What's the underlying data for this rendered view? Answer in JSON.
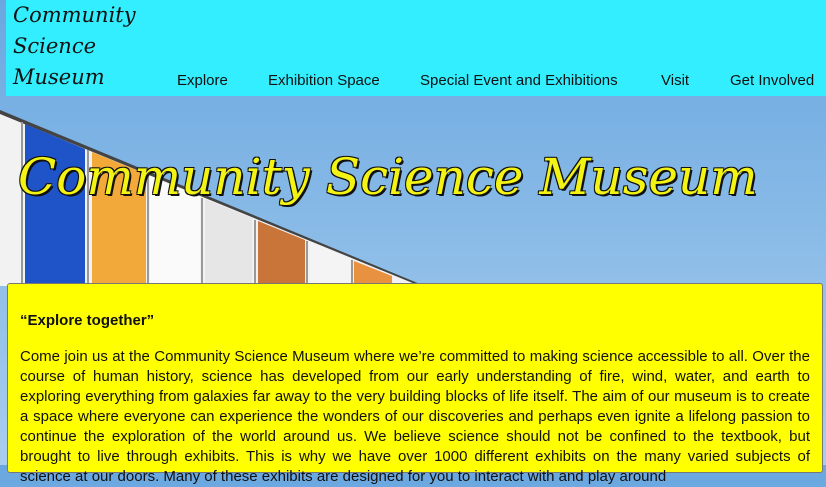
{
  "header": {
    "logo_lines": [
      "Community",
      "Science",
      "Museum"
    ],
    "nav": [
      {
        "label": "Explore"
      },
      {
        "label": "Exhibition Space"
      },
      {
        "label": "Special Event and Exhibitions"
      },
      {
        "label": "Visit"
      },
      {
        "label": "Get Involved"
      }
    ]
  },
  "hero": {
    "title": "Community Science Museum"
  },
  "content": {
    "tagline": "“Explore together”",
    "body": "Come join us at the Community Science Museum where we’re committed to making science accessible to all. Over the course of human history, science has developed from our early understanding of fire, wind, water, and earth to exploring everything from galaxies far away to the very building blocks of life itself. The aim of our museum is to create a space where everyone can experience the wonders of our discoveries and perhaps even ignite a lifelong passion to continue the exploration of the world around us. We believe science should not be confined to the textbook, but brought to live through exhibits. This is why we have over 1000 different exhibits on the many varied subjects of science at our doors. Many of these exhibits are designed for you to interact with and play around"
  },
  "colors": {
    "header_bg": "#33eeff",
    "card_bg": "#ffff00",
    "title_color": "#f3f314"
  }
}
